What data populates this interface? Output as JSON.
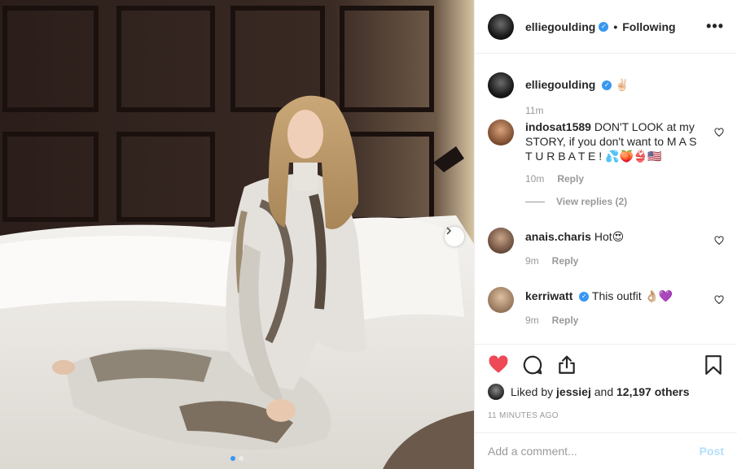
{
  "post": {
    "author": "elliegoulding",
    "verified": true,
    "follow_separator": "•",
    "follow_status": "Following",
    "more_label": "•••"
  },
  "caption": {
    "username": "elliegoulding",
    "text": "✌🏻",
    "time": "11m"
  },
  "comments": [
    {
      "username": "indosat1589",
      "text": "DON'T LOOK at my STORY, if you don't want to M A S T U R B A T E ! 💦🍑👙🇺🇸",
      "time": "10m",
      "reply_label": "Reply",
      "view_replies": "View replies (2)"
    },
    {
      "username": "anais.charis",
      "text": "Hot😍",
      "time": "9m",
      "reply_label": "Reply"
    },
    {
      "username": "kerriwatt",
      "verified": true,
      "text": "This outfit 👌🏼💜",
      "time": "9m",
      "reply_label": "Reply"
    }
  ],
  "likes": {
    "prefix": "Liked by",
    "user": "jessiej",
    "conj": "and",
    "others": "12,197 others"
  },
  "timestamp": "11 MINUTES AGO",
  "add_comment": {
    "placeholder": "Add a comment...",
    "post_label": "Post"
  },
  "colors": {
    "like_red": "#ed4956",
    "verified_blue": "#3897f0",
    "post_disabled": "#b2dffc"
  },
  "icons": {
    "like": "heart-filled-icon",
    "comment": "comment-bubble-icon",
    "share": "share-icon",
    "save": "bookmark-icon",
    "carousel_next": "chevron-right-icon"
  }
}
